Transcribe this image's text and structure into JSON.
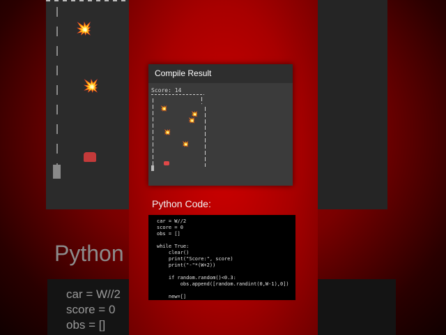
{
  "dialog": {
    "title": "Compile Result",
    "score_text": "Score: 14"
  },
  "code_section": {
    "title": "Python Code:",
    "lines": [
      "car = W//2",
      "score = 0",
      "obs = []",
      "",
      "while True:",
      "    clear()",
      "    print(\"Score:\", score)",
      "    print(\"-\"*(W+2))",
      "",
      "    if random.random()<0.3:",
      "        obs.append([random.randint(0,W-1),0])",
      "",
      "    new=[]"
    ]
  },
  "background": {
    "code_title": "Python",
    "code_lines": [
      "car = W//2",
      "score = 0",
      "obs = []"
    ]
  },
  "icons": {
    "explosion": "💥"
  },
  "colors": {
    "accent": "#c80000",
    "dialog_bg": "#3b3b3b",
    "dialog_header": "#2e2e2e",
    "code_bg": "#000000"
  }
}
